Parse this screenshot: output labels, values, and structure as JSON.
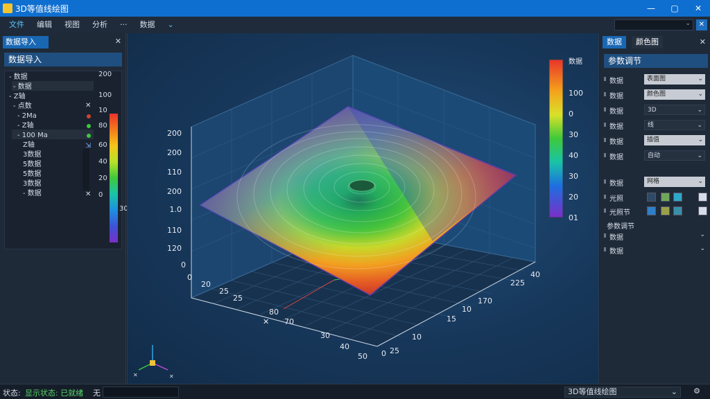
{
  "window": {
    "title": "3D等值线绘图",
    "buttons": [
      "—",
      "▢",
      "✕"
    ]
  },
  "menu": {
    "items": [
      "文件",
      "编辑",
      "视图",
      "分析",
      "···",
      "数据"
    ],
    "search_placeholder": "",
    "close": "✕"
  },
  "left_panel": {
    "tab": "数据导入",
    "close": "✕",
    "header": "数据导入",
    "tree": [
      "数据",
      "数据",
      "Z轴",
      "点数",
      "2Ma",
      "Z轴",
      "100 Ma",
      "Z轴",
      "3数据",
      "5数据",
      "5数据",
      "3数据",
      "数据"
    ],
    "colorbar_labels": [
      "200",
      "100",
      "10",
      "80",
      "60",
      "40",
      "20",
      "0",
      "30"
    ]
  },
  "viewport": {
    "zlabels": [
      "200",
      "200",
      "110",
      "200",
      "1.0",
      "110",
      "120",
      "0"
    ],
    "left_axis_labels": [
      "0",
      "20",
      "25",
      "25",
      "80",
      "70",
      "30",
      "40",
      "50"
    ],
    "right_axis_labels": [
      "40",
      "225",
      "170",
      "10",
      "15",
      "10",
      "25",
      "0"
    ],
    "colorbar_title": "数据",
    "colorbar_labels": [
      "100",
      "0",
      "30",
      "40",
      "30",
      "20",
      "01"
    ]
  },
  "right_panel": {
    "tabs": [
      "数据",
      "颜色图"
    ],
    "close": "✕",
    "header": "参数调节",
    "rows": [
      {
        "label": "数据",
        "value": "表面图"
      },
      {
        "label": "数据",
        "value": "颜色图"
      },
      {
        "label": "数据",
        "value": "3D"
      },
      {
        "label": "数据",
        "value": "线"
      },
      {
        "label": "数据",
        "value": "插值"
      },
      {
        "label": "数据",
        "value": "自动"
      },
      {
        "label": "数据",
        "value": "网格"
      },
      {
        "label": "光照",
        "value": ""
      },
      {
        "label": "光照节",
        "value": ""
      }
    ],
    "section": "参数调节",
    "bottom_rows": [
      "数据",
      "数据"
    ]
  },
  "status": {
    "left": "状态:",
    "middle": "显示状态: 已就绪",
    "extra": "无",
    "right": "3D等值线绘图",
    "gear": "⚙"
  },
  "colors": {
    "title_bar": "#0f6fd0",
    "accent": "#1967b3",
    "panel": "#1f2a38",
    "viewport": "#17375a"
  }
}
